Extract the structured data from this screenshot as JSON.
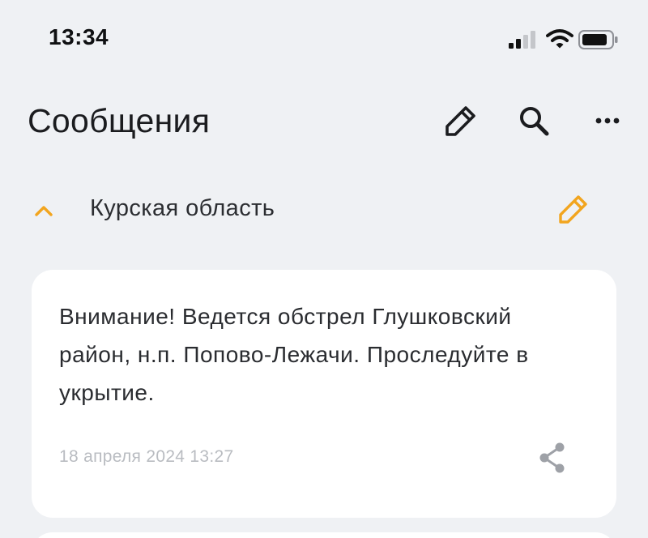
{
  "status_bar": {
    "time": "13:34",
    "icons": [
      "signal-icon",
      "wifi-icon",
      "battery-icon"
    ]
  },
  "header": {
    "title": "Сообщения",
    "actions": [
      "pencil-icon",
      "search-icon",
      "more-icon"
    ]
  },
  "section": {
    "label": "Курская область",
    "expanded": true,
    "icons": [
      "chevron-up-icon",
      "pencil-icon"
    ]
  },
  "messages": [
    {
      "text": "Внимание! Ведется обстрел Глушковский район, н.п. Попово-Лежачи. Проследуйте в укрытие.",
      "date": "18 апреля 2024 13:27",
      "icons": [
        "share-icon"
      ]
    }
  ],
  "colors": {
    "background": "#eff1f4",
    "card": "#ffffff",
    "accent": "#f2a51e",
    "text": "#1d1f22",
    "muted": "#b9bcc1"
  }
}
